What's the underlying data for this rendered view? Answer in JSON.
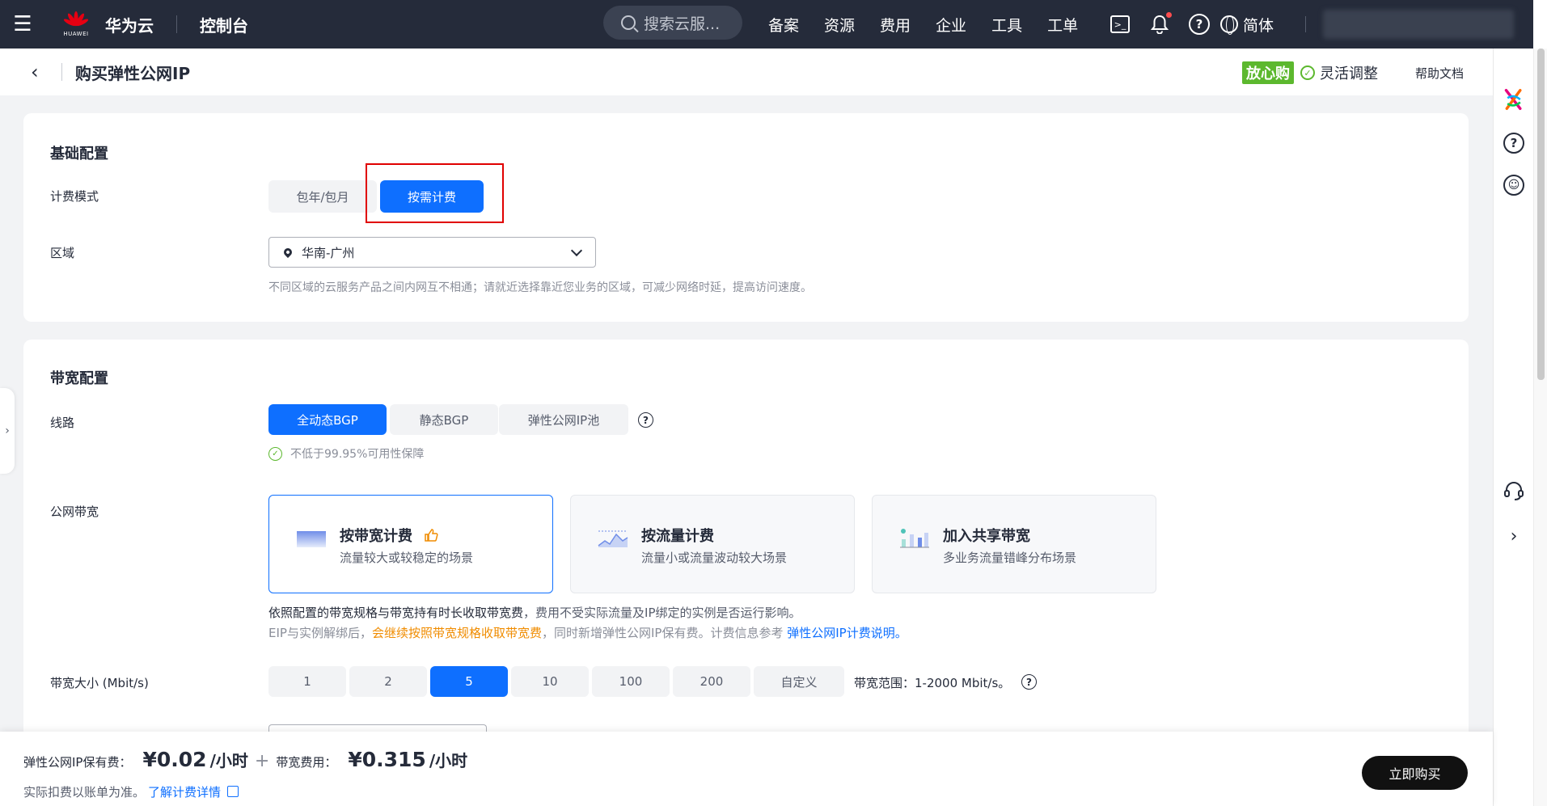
{
  "topbar": {
    "brand_small": "HUAWEI",
    "brand": "华为云",
    "console": "控制台",
    "search_placeholder": "搜索云服...",
    "nav": [
      "备案",
      "资源",
      "费用",
      "企业",
      "工具",
      "工单"
    ],
    "lang": "简体"
  },
  "page": {
    "title": "购买弹性公网IP",
    "worry_badge": "放心购",
    "worry_text": "灵活调整",
    "help_doc": "帮助文档"
  },
  "basic": {
    "title": "基础配置",
    "billing_label": "计费模式",
    "billing_options": [
      "包年/包月",
      "按需计费"
    ],
    "billing_selected": "按需计费",
    "region_label": "区域",
    "region_value": "华南-广州",
    "region_hint": "不同区域的云服务产品之间内网互不相通；请就近选择靠近您业务的区域，可减少网络时延，提高访问速度。"
  },
  "bandwidth": {
    "title": "带宽配置",
    "line_label": "线路",
    "line_options": [
      "全动态BGP",
      "静态BGP",
      "弹性公网IP池"
    ],
    "line_selected": "全动态BGP",
    "availability": "不低于99.95%可用性保障",
    "public_bw_label": "公网带宽",
    "bw_types": [
      {
        "title": "按带宽计费",
        "desc": "流量较大或较稳定的场景"
      },
      {
        "title": "按流量计费",
        "desc": "流量小或流量波动较大场景"
      },
      {
        "title": "加入共享带宽",
        "desc": "多业务流量错峰分布场景"
      }
    ],
    "desc_line1_strong": "依照配置的带宽规格与带宽持有时长收取带宽费",
    "desc_line1_rest": "，费用不受实际流量及IP绑定的实例是否运行影响。",
    "desc_line2_a": "EIP与实例解绑后，",
    "desc_line2_orange": "会继续按照带宽规格收取带宽费",
    "desc_line2_b": "，同时新增弹性公网IP保有费。计费信息参考",
    "desc_line2_link": "弹性公网IP计费说明。",
    "size_label": "带宽大小 (Mbit/s)",
    "size_options": [
      "1",
      "2",
      "5",
      "10",
      "100",
      "200",
      "自定义"
    ],
    "size_selected": "5",
    "size_range": "带宽范围：1-2000 Mbit/s。"
  },
  "footer": {
    "eip_fee_label": "弹性公网IP保有费：",
    "eip_fee": "¥0.02",
    "eip_unit": "/小时",
    "plus": "+",
    "bw_fee_label": "带宽费用：",
    "bw_fee": "¥0.315",
    "bw_unit": "/小时",
    "note": "实际扣费以账单为准。",
    "note_link": "了解计费详情",
    "buy": "立即购买"
  },
  "colors": {
    "accent": "#0e6fff",
    "topbar": "#252b3a",
    "success": "#5cb82e",
    "warning": "#f08c00",
    "highlight_box": "#e00000"
  }
}
